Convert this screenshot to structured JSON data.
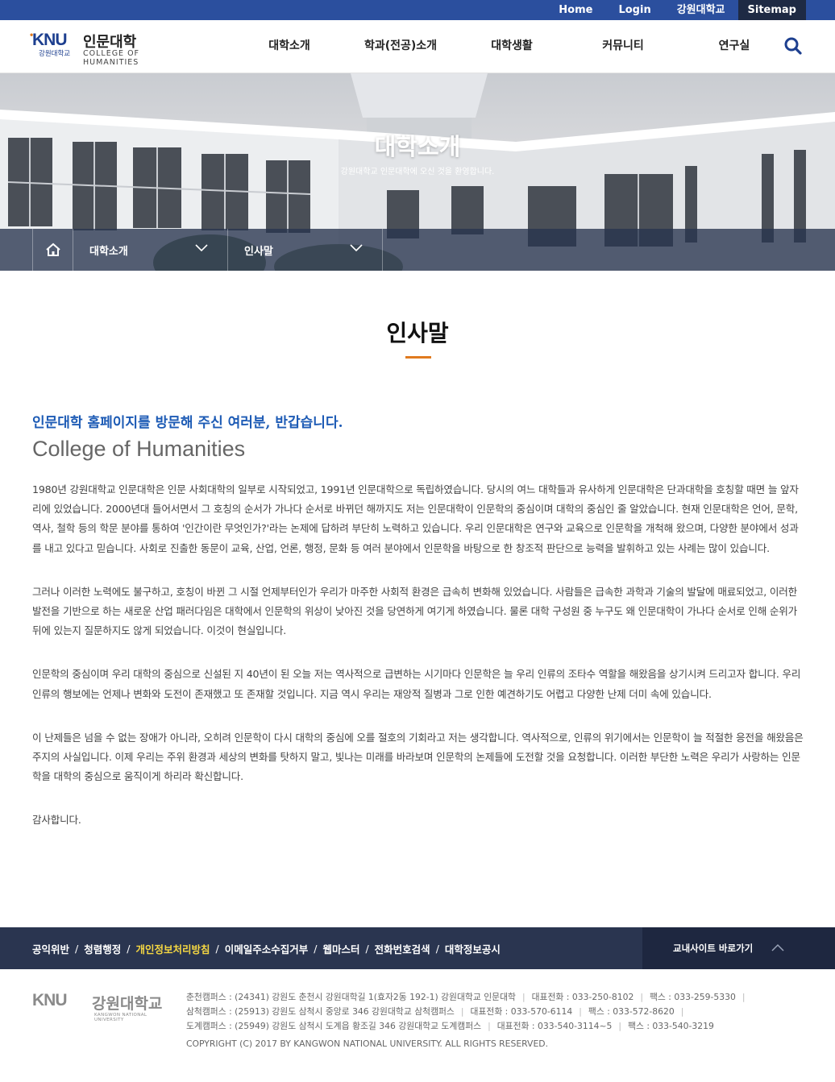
{
  "topbar": {
    "links": [
      "Home",
      "Login",
      "강원대학교"
    ],
    "sitemap": "Sitemap"
  },
  "logo": {
    "knu": "KNU",
    "knu_sub": "강원대학교",
    "kr": "인문대학",
    "en": "COLLEGE OF HUMANITIES"
  },
  "nav": [
    "대학소개",
    "학과(전공)소개",
    "대학생활",
    "커뮤니티",
    "연구실"
  ],
  "visual": {
    "title": "대학소개",
    "subtitle": "강원대학교 인문대학에 오신 것을 환영합니다."
  },
  "breadcrumb": [
    "대학소개",
    "인사말"
  ],
  "content": {
    "title": "인사말",
    "lead": "인문대학 홈페이지를 방문해 주신 여러분, 반갑습니다.",
    "en_heading": "College of Humanities",
    "paragraphs": [
      "1980년 강원대학교 인문대학은 인문 사회대학의 일부로 시작되었고, 1991년 인문대학으로 독립하였습니다. 당시의 여느 대학들과 유사하게 인문대학은 단과대학을 호칭할 때면 늘 앞자리에 있었습니다. 2000년대 들어서면서 그 호칭의 순서가 가나다 순서로 바뀌던 해까지도 저는 인문대학이 인문학의 중심이며 대학의 중심인 줄 알았습니다. 현재 인문대학은 언어, 문학, 역사, 철학 등의 학문 분야를 통하여 '인간이란 무엇인가?'라는 논제에 답하려 부단히 노력하고 있습니다. 우리 인문대학은 연구와 교육으로 인문학을 개척해 왔으며, 다양한 분야에서 성과를 내고 있다고 믿습니다. 사회로 진출한 동문이 교육, 산업, 언론, 행정, 문화 등 여러 분야에서 인문학을 바탕으로 한 창조적 판단으로 능력을 발휘하고 있는 사례는 많이 있습니다.",
      "그러나 이러한 노력에도 불구하고, 호칭이 바뀐 그 시절 언제부터인가 우리가 마주한 사회적 환경은 급속히 변화해 있었습니다. 사람들은 급속한 과학과 기술의 발달에 매료되었고, 이러한 발전을 기반으로 하는 새로운 산업 패러다임은 대학에서 인문학의 위상이 낮아진 것을 당연하게 여기게 하였습니다. 물론 대학 구성원 중 누구도 왜 인문대학이 가나다 순서로 인해 순위가 뒤에 있는지 질문하지도 않게 되었습니다. 이것이 현실입니다.",
      "인문학의 중심이며 우리 대학의 중심으로 신설된 지 40년이 된 오늘 저는 역사적으로 급변하는 시기마다 인문학은 늘 우리 인류의 조타수 역할을 해왔음을 상기시켜 드리고자 합니다. 우리 인류의 행보에는 언제나 변화와 도전이 존재했고 또 존재할 것입니다. 지금 역시 우리는 재앙적 질병과 그로 인한 예견하기도 어렵고 다양한 난제 더미 속에 있습니다.",
      "이 난제들은 넘을 수 없는 장애가 아니라, 오히려 인문학이 다시 대학의 중심에 오를 절호의 기회라고 저는 생각합니다. 역사적으로, 인류의 위기에서는 인문학이 늘 적절한 응전을 해왔음은 주지의 사실입니다. 이제 우리는 주위 환경과 세상의 변화를 탓하지 말고, 빛나는 미래를 바라보며 인문학의 논제들에 도전할 것을 요청합니다. 이러한 부단한 노력은 우리가 사랑하는 인문학을 대학의 중심으로 움직이게 하리라 확신합니다."
    ],
    "thanks": "감사합니다."
  },
  "footer_links": [
    "공익위반",
    "청렴행정",
    "개인정보처리방침",
    "이메일주소수집거부",
    "웹마스터",
    "전화번호검색",
    "대학정보공시"
  ],
  "footer_sites": "교내사이트 바로가기",
  "footer_logo": {
    "knu": "KNU",
    "kr": "강원대학교",
    "en": "KANGWON NATIONAL UNIVERSITY"
  },
  "footer_info": {
    "rows": [
      [
        "춘천캠퍼스 : (24341) 강원도 춘천시 강원대학길 1(효자2동 192-1) 강원대학교 인문대학",
        "대표전화 : 033-250-8102",
        "팩스 : 033-259-5330"
      ],
      [
        "삼척캠퍼스 : (25913) 강원도 삼척시 중앙로 346 강원대학교 삼척캠퍼스",
        "대표전화 : 033-570-6114",
        "팩스 : 033-572-8620"
      ],
      [
        "도계캠퍼스 : (25949) 강원도 삼척시 도계읍 황조길 346 강원대학교 도계캠퍼스",
        "대표전화 : 033-540-3114~5",
        "팩스 : 033-540-3219"
      ]
    ],
    "copyright": "COPYRIGHT (C) 2017 BY KANGWON NATIONAL UNIVERSITY. ALL RIGHTS RESERVED."
  },
  "colors": {
    "topbar": "#2b4f9e",
    "accent": "#e07a1f",
    "lead": "#1d5bb5",
    "footer_bar": "#2a3550",
    "footer_highlight": "#f5d742"
  },
  "icons": [
    "search-icon",
    "home-icon",
    "chevron-down-icon",
    "chevron-up-icon"
  ]
}
